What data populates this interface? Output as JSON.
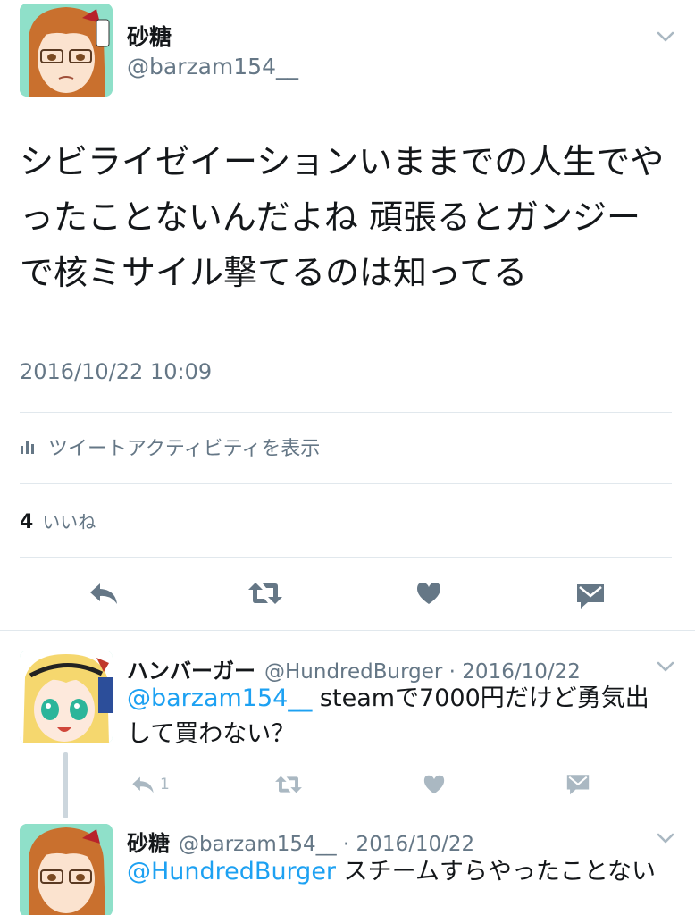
{
  "main_tweet": {
    "display_name": "砂糖",
    "handle": "@barzam154__",
    "text": "シビライゼイーションいままでの人生でやったことないんだよね 頑張るとガンジーで核ミサイル撃てるのは知ってる",
    "timestamp": "2016/10/22 10:09",
    "activity_label": "ツイートアクティビティを表示",
    "likes_count": "4",
    "likes_label": "いいね"
  },
  "replies": [
    {
      "display_name": "ハンバーガー",
      "meta": "@HundredBurger · 2016/10/22",
      "mention": "@barzam154__",
      "text": " steamで7000円だけど勇気出して買わない？",
      "reply_count": "1"
    },
    {
      "display_name": "砂糖",
      "meta": "@barzam154__ · 2016/10/22",
      "mention": "@HundredBurger",
      "text": " スチームすらやったことない"
    }
  ],
  "icons": {
    "menu": "chevron-down-icon",
    "activity": "bar-chart-icon",
    "reply": "reply-icon",
    "retweet": "retweet-icon",
    "like": "heart-icon",
    "message": "envelope-icon"
  },
  "colors": {
    "text": "#14171a",
    "secondary": "#657786",
    "icon": "#657786",
    "icon_light": "#aab8c2",
    "link": "#1da1f2",
    "divider": "#e1e8ed"
  }
}
